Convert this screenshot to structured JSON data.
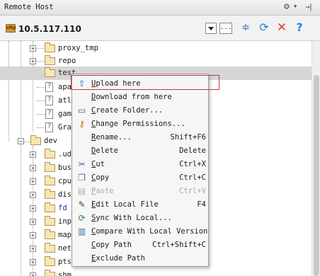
{
  "window": {
    "title": "Remote Host"
  },
  "host": {
    "name": "10.5.117.110",
    "icon_text": "sftp"
  },
  "toolbar": {
    "more_label": "...",
    "icons": [
      "collapse-all-icon",
      "sync-icon",
      "close-icon",
      "help-icon"
    ]
  },
  "tree": {
    "rows": [
      {
        "label": "proxy_tmp"
      },
      {
        "label": "repo"
      },
      {
        "label": "test"
      },
      {
        "label": "apa"
      },
      {
        "label": "atl"
      },
      {
        "label": "gam"
      },
      {
        "label": "Gra"
      },
      {
        "label": "dev"
      },
      {
        "label": ".ud"
      },
      {
        "label": "bus"
      },
      {
        "label": "cpu"
      },
      {
        "label": "dis"
      },
      {
        "label": "fd"
      },
      {
        "label": "inp"
      },
      {
        "label": "map"
      },
      {
        "label": "net"
      },
      {
        "label": "pts"
      },
      {
        "label": "shm"
      }
    ]
  },
  "context_menu": {
    "items": [
      {
        "label": "Upload here",
        "shortcut": "",
        "icon": "upload-icon"
      },
      {
        "label": "Download from here",
        "shortcut": "",
        "icon": "download-icon"
      },
      {
        "label": "Create Folder...",
        "shortcut": "",
        "icon": "folder-icon"
      },
      {
        "label": "Change Permissions...",
        "shortcut": "",
        "icon": "permissions-icon"
      },
      {
        "label": "Rename...",
        "shortcut": "Shift+F6",
        "icon": ""
      },
      {
        "label": "Delete",
        "shortcut": "Delete",
        "icon": ""
      },
      {
        "label": "Cut",
        "shortcut": "Ctrl+X",
        "icon": "cut-icon"
      },
      {
        "label": "Copy",
        "shortcut": "Ctrl+C",
        "icon": "copy-icon"
      },
      {
        "label": "Paste",
        "shortcut": "Ctrl+V",
        "icon": "paste-icon"
      },
      {
        "label": "Edit Local File",
        "shortcut": "F4",
        "icon": "edit-icon"
      },
      {
        "label": "Sync With Local...",
        "shortcut": "",
        "icon": "sync-icon"
      },
      {
        "label": "Compare With Local Version",
        "shortcut": "",
        "icon": "compare-icon"
      },
      {
        "label": "Copy Path",
        "shortcut": "Ctrl+Shift+C",
        "icon": ""
      },
      {
        "label": "Exclude Path",
        "shortcut": "",
        "icon": ""
      }
    ]
  },
  "colors": {
    "link": "#1c2fb4",
    "highlight_box": "#cc3333",
    "selection": "#d6d6d6"
  }
}
